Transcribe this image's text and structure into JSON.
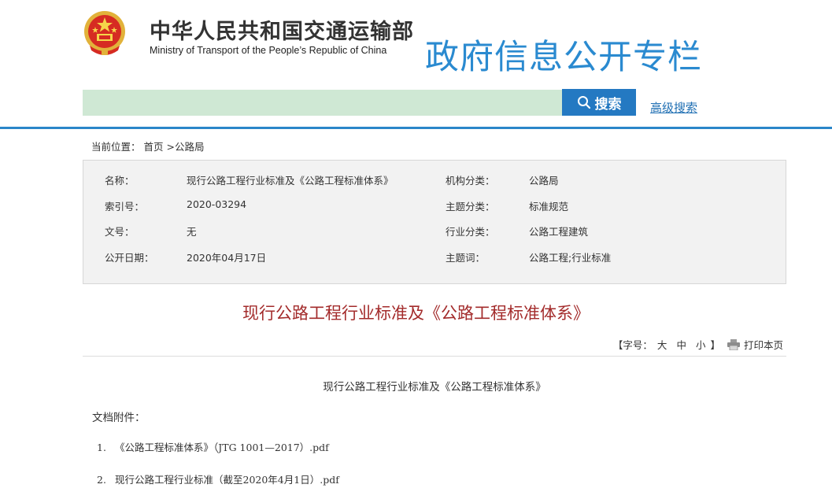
{
  "header": {
    "ministry_cn": "中华人民共和国交通运输部",
    "ministry_en": "Ministry of Transport of the People’s Republic of China",
    "column_title": "政府信息公开专栏",
    "search_label": "搜索",
    "search_value": "",
    "advanced_search": "高级搜索",
    "emblem_icon": "national-emblem-icon"
  },
  "breadcrumb": {
    "prefix": "当前位置：",
    "home": "首页",
    "separator": " >",
    "current": "公路局"
  },
  "meta": {
    "name_label": "名称：",
    "name_value": "现行公路工程行业标准及《公路工程标准体系》",
    "org_label": "机构分类：",
    "org_value": "公路局",
    "index_label": "索引号：",
    "index_value": "2020-03294",
    "topic_label": "主题分类：",
    "topic_value": "标准规范",
    "docno_label": "文号：",
    "docno_value": "无",
    "industry_label": "行业分类：",
    "industry_value": "公路工程建筑",
    "date_label": "公开日期：",
    "date_value": "2020年04月17日",
    "keywords_label": "主题词：",
    "keywords_value": "公路工程;行业标准"
  },
  "document": {
    "title": "现行公路工程行业标准及《公路工程标准体系》",
    "content_title": "现行公路工程行业标准及《公路工程标准体系》",
    "attachments_label": "文档附件：",
    "attachments": [
      {
        "num": "1.",
        "label": "《公路工程标准体系》（JTG 1001—2017）.pdf"
      },
      {
        "num": "2.",
        "label": "现行公路工程行业标准（截至2020年4月1日）.pdf"
      }
    ]
  },
  "tools": {
    "font_prefix": "【字号：",
    "large": "大",
    "medium": "中",
    "small": "小",
    "font_suffix": "】",
    "print": "打印本页",
    "print_icon": "printer-icon"
  },
  "colors": {
    "accent_blue": "#2a86c9",
    "search_bg": "#cfe8d4",
    "title_red": "#a32b2b"
  }
}
